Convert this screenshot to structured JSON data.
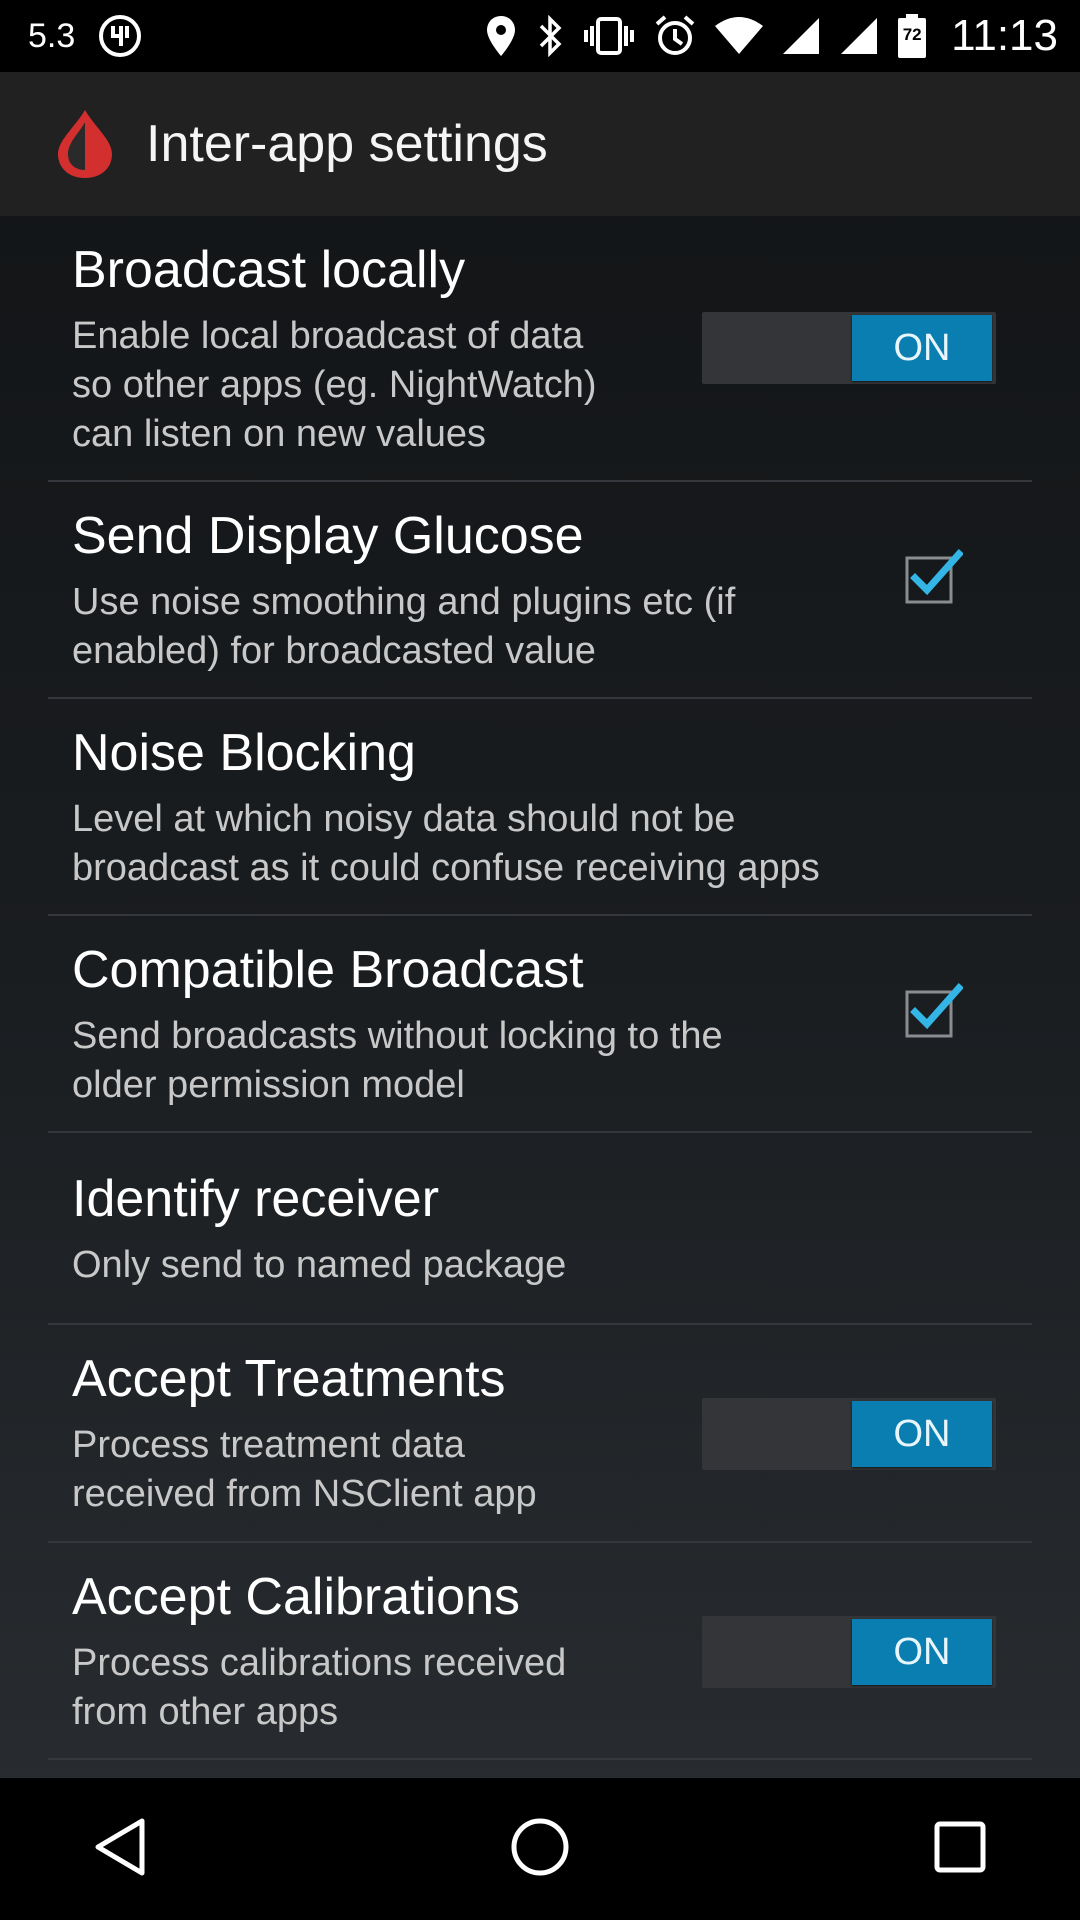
{
  "status_bar": {
    "version_text": "5.3",
    "battery_level": "72",
    "time": "11:13",
    "icons": [
      "app-notification-icon",
      "location-icon",
      "bluetooth-icon",
      "vibrate-icon",
      "alarm-icon",
      "wifi-icon",
      "signal-icon",
      "signal-icon",
      "battery-icon"
    ]
  },
  "app_bar": {
    "title": "Inter-app settings",
    "logo_color": "#d32f2f"
  },
  "settings": [
    {
      "title": "Broadcast locally",
      "summary": "Enable local broadcast of data\nso other apps (eg. NightWatch)\ncan listen on new values",
      "control": "toggle",
      "state": "ON"
    },
    {
      "title": "Send Display Glucose",
      "summary": "Use noise smoothing and plugins etc (if\nenabled) for broadcasted value",
      "control": "checkbox",
      "checked": true
    },
    {
      "title": "Noise Blocking",
      "summary": "Level at which noisy data should not be\nbroadcast as it could confuse receiving apps",
      "control": "none"
    },
    {
      "title": "Compatible Broadcast",
      "summary": "Send broadcasts without locking to the\nolder permission model",
      "control": "checkbox",
      "checked": true
    },
    {
      "title": "Identify receiver",
      "summary": "Only send to named package",
      "control": "none"
    },
    {
      "title": "Accept Treatments",
      "summary": "Process treatment data\nreceived from NSClient app",
      "control": "toggle",
      "state": "ON"
    },
    {
      "title": "Accept Calibrations",
      "summary": "Process calibrations received\nfrom other apps",
      "control": "toggle",
      "state": "ON"
    }
  ],
  "colors": {
    "accent": "#0b7eb1",
    "checkmark": "#33b5e5",
    "divider": "#34383c"
  },
  "nav_bar": {
    "icons": [
      "back-icon",
      "home-icon",
      "recents-icon"
    ]
  }
}
